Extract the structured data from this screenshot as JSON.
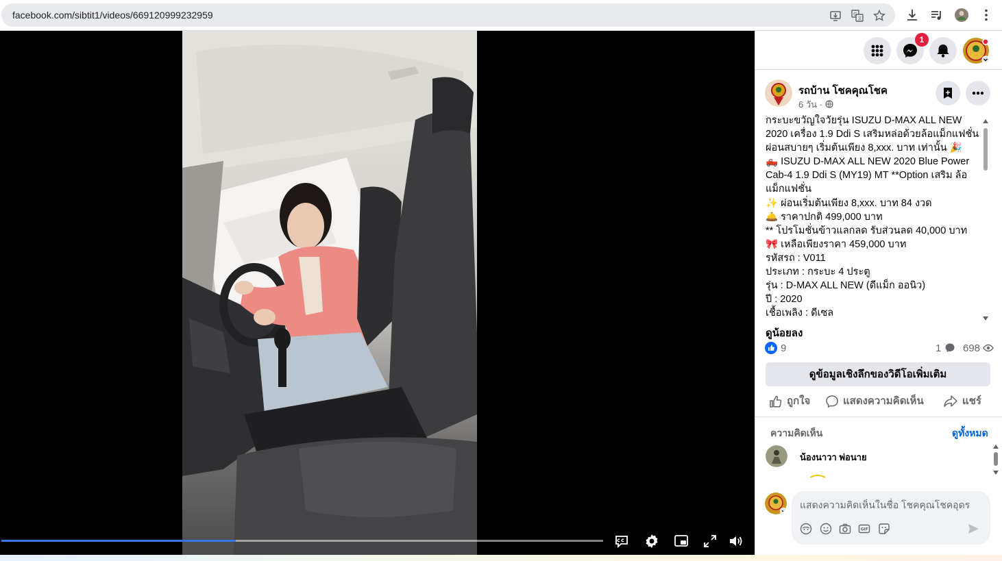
{
  "browser": {
    "url": "facebook.com/sibtit1/videos/669120999232959",
    "icons": [
      "install-app-icon",
      "translate-icon",
      "bookmark-star-icon",
      "download-icon",
      "media-control-icon",
      "profile-avatar",
      "kebab-menu-icon"
    ]
  },
  "video": {
    "progress_fraction": 0.39,
    "controls": [
      "captions-icon",
      "settings-gear-icon",
      "picture-in-picture-icon",
      "fullscreen-icon",
      "volume-icon"
    ]
  },
  "header": {
    "messenger_badge": "1",
    "icons": [
      "menu-grid-icon",
      "messenger-icon",
      "notifications-bell-icon",
      "account-avatar"
    ]
  },
  "post": {
    "page_name": "รถบ้าน โชคคุณโชค",
    "time": "6 วัน ·",
    "description_lines": [
      "กระบะขวัญใจวัยรุ่น ISUZU D-MAX ALL NEW 2020 เครื่อง 1.9 Ddi S เสริมหล่อด้วยล้อแม็กแฟชั่น ผ่อนสบายๆ เริ่มต้นเพียง 8,xxx. บาท เท่านั้น 🎉",
      "🛻 ISUZU D-MAX ALL NEW 2020 Blue Power Cab-4 1.9 Ddi S (MY19) MT **Option เสริม ล้อแม็กแฟชั่น",
      "✨ ผ่อนเริ่มต้นเพียง 8,xxx. บาท 84 งวด",
      "🛎️ ราคาปกติ 499,000 บาท",
      "** โปรโมชั่นข้าวแลกลด รับส่วนลด 40,000 บาท",
      "🎀 เหลือเพียงราคา 459,000 บาท",
      "รหัสรถ : V011",
      "ประเภท : กระบะ 4 ประตู",
      "รุ่น : D-MAX ALL NEW (ดีแม็ก ออนิว)",
      "ปี : 2020",
      "เชื้อเพลิง : ดีเซล"
    ],
    "see_less": "ดูน้อยลง",
    "likes": "9",
    "comments": "1",
    "views": "698",
    "insights_button": "ดูข้อมูลเชิงลึกของวิดีโอเพิ่มเติม",
    "actions": {
      "like": "ถูกใจ",
      "comment": "แสดงความคิดเห็น",
      "share": "แชร์"
    }
  },
  "comments": {
    "label": "ความคิดเห็น",
    "see_all": "ดูทั้งหมด",
    "first_commenter": "น้องนาวา พ่อนาย",
    "composer_placeholder": "แสดงความคิดเห็นในชื่อ โชคคุณโชคอุดร",
    "composer_icons": [
      "avatar-sticker-icon",
      "emoji-icon",
      "camera-icon",
      "gif-icon",
      "sticker-icon",
      "send-icon"
    ]
  },
  "colors": {
    "facebook_blue": "#0866ff",
    "progress_blue": "#3578e5",
    "badge_red": "#e41e3f",
    "button_gray": "#e4e6eb"
  }
}
